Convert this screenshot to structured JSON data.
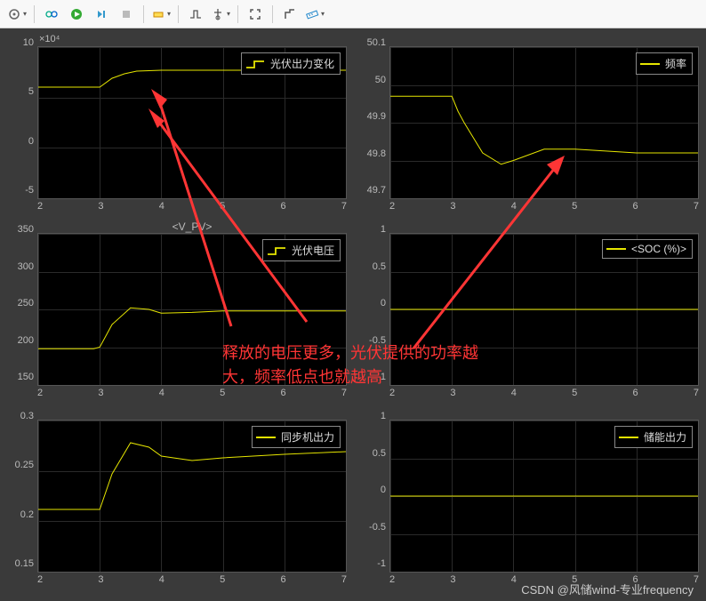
{
  "toolbar": {
    "icons": [
      "settings",
      "layout",
      "run",
      "step-fwd",
      "stop",
      "highlight",
      "signal",
      "cursor",
      "fullscreen",
      "trigger",
      "ruler"
    ]
  },
  "annotation": {
    "text1": "释放的电压更多，光伏提供的功率越",
    "text2": "大，频率低点也就越高"
  },
  "watermark": "CSDN @风储wind-专业frequency",
  "charts": [
    {
      "id": "pv-power",
      "multiplier": "×10⁴",
      "title": "",
      "legend": "光伏出力变化",
      "legend_style": "step",
      "yticks": [
        "-5",
        "0",
        "5",
        "10"
      ],
      "xticks": [
        "2",
        "3",
        "4",
        "5",
        "6",
        "7"
      ]
    },
    {
      "id": "freq",
      "multiplier": "",
      "title": "",
      "legend": "频率",
      "legend_style": "line",
      "yticks": [
        "49.7",
        "49.8",
        "49.9",
        "50",
        "50.1"
      ],
      "xticks": [
        "2",
        "3",
        "4",
        "5",
        "6",
        "7"
      ]
    },
    {
      "id": "vpv",
      "multiplier": "",
      "title": "<V_PV>",
      "legend": "光伏电压",
      "legend_style": "step",
      "yticks": [
        "150",
        "200",
        "250",
        "300",
        "350"
      ],
      "xticks": [
        "2",
        "3",
        "4",
        "5",
        "6",
        "7"
      ]
    },
    {
      "id": "soc",
      "multiplier": "",
      "title": "",
      "legend": "<SOC (%)>",
      "legend_style": "line",
      "yticks": [
        "-1",
        "-0.5",
        "0",
        "0.5",
        "1"
      ],
      "xticks": [
        "2",
        "3",
        "4",
        "5",
        "6",
        "7"
      ]
    },
    {
      "id": "sync",
      "multiplier": "",
      "title": "",
      "legend": "同步机出力",
      "legend_style": "line",
      "yticks": [
        "0.15",
        "0.2",
        "0.25",
        "0.3"
      ],
      "xticks": [
        "2",
        "3",
        "4",
        "5",
        "6",
        "7"
      ]
    },
    {
      "id": "ess",
      "multiplier": "",
      "title": "",
      "legend": "储能出力",
      "legend_style": "line",
      "yticks": [
        "-1",
        "-0.5",
        "0",
        "0.5",
        "1"
      ],
      "xticks": [
        "2",
        "3",
        "4",
        "5",
        "6",
        "7"
      ]
    }
  ],
  "chart_data": [
    {
      "type": "line",
      "id": "pv-power",
      "title": "光伏出力变化",
      "x": [
        2,
        2.5,
        3,
        3.2,
        3.4,
        3.6,
        4,
        5,
        6,
        7
      ],
      "y": [
        7.5,
        7.5,
        7.5,
        8.5,
        9.0,
        9.3,
        9.4,
        9.4,
        9.4,
        9.4
      ],
      "ylim": [
        -5,
        12
      ],
      "xlim": [
        2,
        7
      ],
      "y_scale": "1e4"
    },
    {
      "type": "line",
      "id": "freq",
      "title": "频率",
      "x": [
        2,
        2.8,
        3,
        3.1,
        3.2,
        3.5,
        3.8,
        4,
        4.5,
        5,
        6,
        7
      ],
      "y": [
        49.97,
        49.97,
        49.97,
        49.93,
        49.9,
        49.82,
        49.79,
        49.8,
        49.83,
        49.83,
        49.82,
        49.82
      ],
      "ylim": [
        49.7,
        50.1
      ],
      "xlim": [
        2,
        7
      ]
    },
    {
      "type": "line",
      "id": "vpv",
      "title": "<V_PV> 光伏电压",
      "x": [
        2,
        2.9,
        3,
        3.2,
        3.5,
        3.8,
        4,
        4.5,
        5,
        6,
        7
      ],
      "y": [
        198,
        198,
        200,
        230,
        252,
        250,
        245,
        246,
        248,
        248,
        248
      ],
      "ylim": [
        150,
        350
      ],
      "xlim": [
        2,
        7
      ]
    },
    {
      "type": "line",
      "id": "soc",
      "title": "<SOC (%)>",
      "x": [
        2,
        7
      ],
      "y": [
        0,
        0
      ],
      "ylim": [
        -1,
        1
      ],
      "xlim": [
        2,
        7
      ]
    },
    {
      "type": "line",
      "id": "sync",
      "title": "同步机出力",
      "x": [
        2,
        2.9,
        3,
        3.2,
        3.5,
        3.8,
        4,
        4.5,
        5,
        6,
        7
      ],
      "y": [
        0.22,
        0.22,
        0.22,
        0.26,
        0.295,
        0.29,
        0.28,
        0.275,
        0.278,
        0.282,
        0.285
      ],
      "ylim": [
        0.15,
        0.32
      ],
      "xlim": [
        2,
        7
      ]
    },
    {
      "type": "line",
      "id": "ess",
      "title": "储能出力",
      "x": [
        2,
        7
      ],
      "y": [
        0,
        0
      ],
      "ylim": [
        -1,
        1
      ],
      "xlim": [
        2,
        7
      ]
    }
  ]
}
